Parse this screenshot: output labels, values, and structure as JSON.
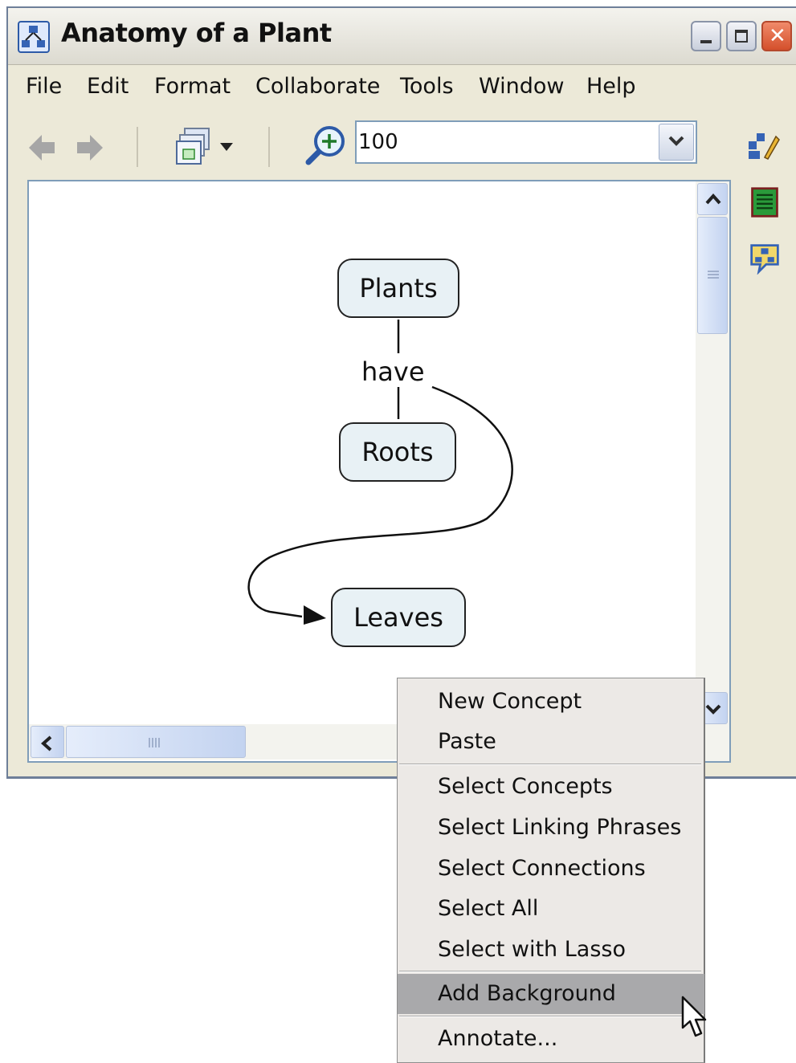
{
  "window": {
    "title": "Anatomy of a Plant",
    "controls": [
      "minimize-icon",
      "maximize-icon",
      "close-icon"
    ]
  },
  "menubar": {
    "items": [
      "File",
      "Edit",
      "Format",
      "Collaborate",
      "Tools",
      "Window",
      "Help"
    ]
  },
  "toolbar": {
    "zoom_value": "100",
    "icons": [
      "back-arrow-icon",
      "forward-arrow-icon",
      "view-switch-icon",
      "zoom-icon",
      "dropdown-icon",
      "styles-icon"
    ]
  },
  "concept_map": {
    "concepts": [
      "Plants",
      "Roots",
      "Leaves"
    ],
    "linking_phrase": "have"
  },
  "side_panel": {
    "icons": [
      "styles-icon",
      "properties-icon",
      "collaboration-icon"
    ]
  },
  "context_menu": {
    "items": [
      {
        "label": "New Concept",
        "highlighted": false
      },
      {
        "label": "Paste",
        "highlighted": false
      },
      {
        "label": "Select Concepts",
        "highlighted": false
      },
      {
        "label": "Select Linking Phrases",
        "highlighted": false
      },
      {
        "label": "Select Connections",
        "highlighted": false
      },
      {
        "label": "Select All",
        "highlighted": false
      },
      {
        "label": "Select with Lasso",
        "highlighted": false
      },
      {
        "label": "Add Background",
        "highlighted": true
      },
      {
        "label": "Annotate...",
        "highlighted": false
      }
    ]
  },
  "colors": {
    "window_bg": "#ece9d8",
    "concept_fill": "#e8f1f5",
    "menu_highlight": "#a9a9ab"
  }
}
